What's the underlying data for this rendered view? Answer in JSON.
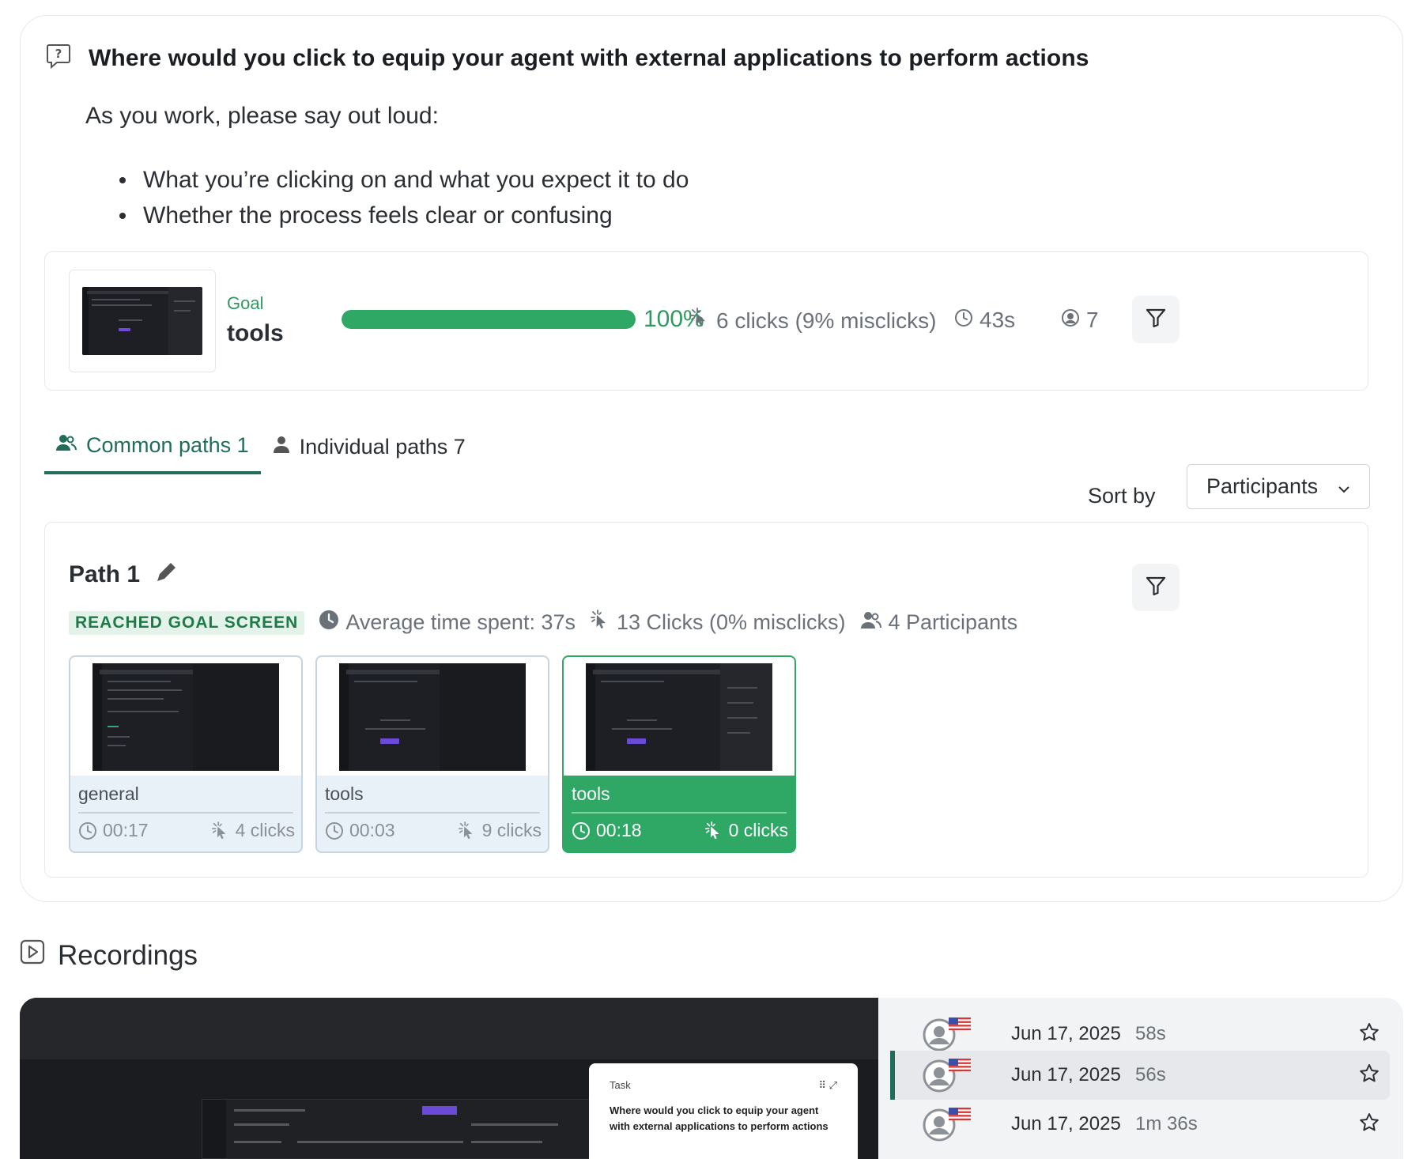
{
  "task": {
    "title": "Where would you click to equip your agent with external applications to perform actions",
    "intro": "As you work, please say out loud:",
    "bullets": [
      "What you’re clicking on and what you expect it to do",
      "Whether the process feels clear or confusing"
    ]
  },
  "goal": {
    "label": "Goal",
    "name": "tools",
    "success_fraction": 1.0,
    "success_text": "100%",
    "clicks_text": "6 clicks (9% misclicks)",
    "time_text": "43s",
    "participants_text": "7"
  },
  "tabs": [
    {
      "label": "Common paths 1",
      "active": true
    },
    {
      "label": "Individual paths 7",
      "active": false
    }
  ],
  "sort": {
    "label": "Sort by",
    "value": "Participants"
  },
  "path": {
    "title": "Path 1",
    "badge": "REACHED GOAL SCREEN",
    "avg_time": "Average time spent: 37s",
    "clicks": "13 Clicks (0% misclicks)",
    "participants": "4 Participants",
    "steps": [
      {
        "label": "general",
        "time": "00:17",
        "clicks": "4 clicks",
        "current": false
      },
      {
        "label": "tools",
        "time": "00:03",
        "clicks": "9 clicks",
        "current": false
      },
      {
        "label": "tools",
        "time": "00:18",
        "clicks": "0 clicks",
        "current": true
      }
    ]
  },
  "recordings": {
    "title": "Recordings",
    "task_popup": {
      "label": "Task",
      "text": "Where would you click to equip your agent with external applications to perform actions"
    },
    "items": [
      {
        "date": "Jun 17, 2025",
        "duration": "58s",
        "selected": false
      },
      {
        "date": "Jun 17, 2025",
        "duration": "56s",
        "selected": true
      },
      {
        "date": "Jun 17, 2025",
        "duration": "1m 36s",
        "selected": false
      }
    ]
  },
  "colors": {
    "accent": "#1f6d5a",
    "success": "#2fa866",
    "muted": "#6b7178"
  }
}
